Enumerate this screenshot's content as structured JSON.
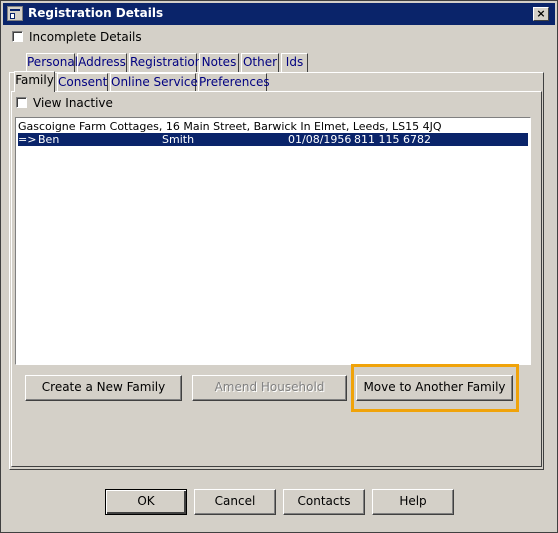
{
  "window": {
    "title": "Registration Details",
    "close_symbol": "×"
  },
  "incomplete": {
    "label": "Incomplete Details",
    "checked": false
  },
  "top_tabs": [
    {
      "label": "Personal"
    },
    {
      "label": "Address"
    },
    {
      "label": "Registration"
    },
    {
      "label": "Notes"
    },
    {
      "label": "Other"
    },
    {
      "label": "Ids"
    }
  ],
  "sub_tabs": [
    {
      "label": "Family",
      "active": true
    },
    {
      "label": "Consent"
    },
    {
      "label": "Online Services"
    },
    {
      "label": "Preferences"
    }
  ],
  "view_inactive": {
    "label": "View Inactive",
    "checked": false
  },
  "family_list": {
    "address": "Gascoigne Farm Cottages, 16 Main Street, Barwick In Elmet, Leeds, LS15 4JQ",
    "members": [
      {
        "marker": "=>",
        "first_name": "Ben",
        "surname": "Smith",
        "dob": "01/08/1956",
        "nhs_number": "811 115 6782",
        "selected": true
      }
    ]
  },
  "family_buttons": {
    "create": "Create a New Family",
    "amend": "Amend Household",
    "move": "Move to Another Family"
  },
  "footer_buttons": {
    "ok": "OK",
    "cancel": "Cancel",
    "contacts": "Contacts",
    "help": "Help"
  },
  "colors": {
    "highlight": "#f0a30a",
    "selection": "#0a246a",
    "titlebar": "#0a246a",
    "tab_text": "#000080"
  }
}
